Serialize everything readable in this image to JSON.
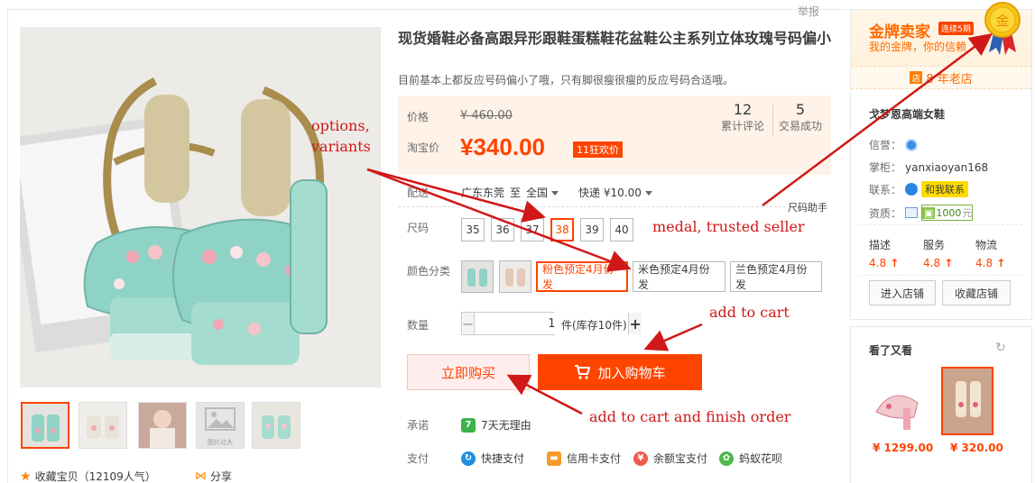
{
  "report": "举报",
  "gallery": {
    "thumbnails": [
      {
        "name": "thumb-1",
        "active": true
      },
      {
        "name": "thumb-2",
        "active": false
      },
      {
        "name": "thumb-3",
        "active": false
      },
      {
        "name": "thumb-4",
        "active": false,
        "placeholder": "图片过大"
      },
      {
        "name": "thumb-5",
        "active": false
      }
    ],
    "favorite": "收藏宝贝（12109人气）",
    "share": "分享"
  },
  "product": {
    "title": "现货婚鞋必备高跟异形跟鞋蛋糕鞋花盆鞋公主系列立体玫瑰号码偏小",
    "subtitle": "目前基本上都反应号码偏小了哦，只有脚很瘦很瘦的反应号码合适哦。"
  },
  "price": {
    "orig_label": "价格",
    "orig_value": "¥ 460.00",
    "promo_label": "淘宝价",
    "promo_value": "¥340.00",
    "promo_tag": "11狂欢价",
    "reviews_count": "12",
    "reviews_label": "累计评论",
    "sales_count": "5",
    "sales_label": "交易成功"
  },
  "shipping": {
    "label": "配送",
    "from": "广东东莞",
    "to_word": "至",
    "to": "全国",
    "express": "快递 ¥10.00"
  },
  "size": {
    "label": "尺码",
    "helper": "尺码助手",
    "options": [
      "35",
      "36",
      "37",
      "38",
      "39",
      "40"
    ],
    "selected": "38"
  },
  "color": {
    "label": "颜色分类",
    "options": [
      "粉色预定4月份发",
      "米色预定4月份发",
      "兰色预定4月份发"
    ],
    "selected": "粉色预定4月份发"
  },
  "quantity": {
    "label": "数量",
    "value": "1",
    "minus": "−",
    "plus": "+",
    "stock": "件(库存10件)"
  },
  "actions": {
    "buy_now": "立即购买",
    "add_to_cart": "加入购物车"
  },
  "promise": {
    "label": "承诺",
    "icon_text": "7",
    "text": "7天无理由"
  },
  "payment": {
    "label": "支付",
    "methods": [
      "快捷支付",
      "信用卡支付",
      "余额宝支付",
      "蚂蚁花呗"
    ]
  },
  "shop": {
    "gold_seller": "金牌卖家",
    "years_badge": "连续5期",
    "gold_sub": "我的金牌，你的信赖",
    "medal_char": "金",
    "store_icon": "店",
    "store_age": "8 年老店",
    "name": "戈梦恩高端女鞋",
    "credit_label": "信誉：",
    "keeper_label": "掌柜：",
    "keeper": "yanxiaoyan168",
    "contact_label": "联系：",
    "contact_btn": "和我联系",
    "qual_label": "资质：",
    "qual_value": "1000",
    "qual_unit": "元",
    "dsr": [
      {
        "label": "描述",
        "score": "4.8"
      },
      {
        "label": "服务",
        "score": "4.8"
      },
      {
        "label": "物流",
        "score": "4.8"
      }
    ],
    "enter_shop": "进入店铺",
    "collect_shop": "收藏店铺"
  },
  "recommend": {
    "title": "看了又看",
    "items": [
      {
        "price": "¥ 1299.00"
      },
      {
        "price": "¥ 320.00"
      }
    ]
  },
  "annotations": {
    "options": "options,",
    "variants": "variants",
    "medal": "medal, trusted seller",
    "add_to_cart": "add to cart",
    "finish_order": "add to cart and finish order"
  },
  "colors": {
    "accent": "#ff4400",
    "annotation": "#d01818",
    "price_bg": "#fff2e8",
    "gold": "#ff6a00"
  }
}
